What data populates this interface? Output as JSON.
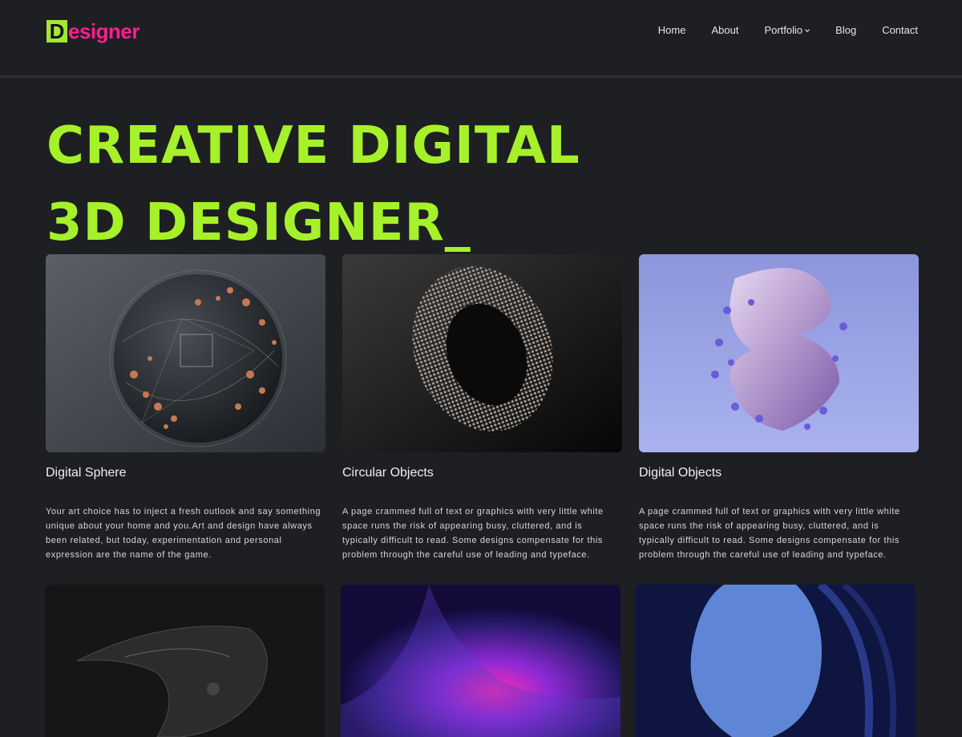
{
  "logo": {
    "initial": "D",
    "rest": "esigner"
  },
  "nav": {
    "items": [
      {
        "label": "Home"
      },
      {
        "label": "About"
      },
      {
        "label": "Portfolio"
      },
      {
        "label": "Blog"
      },
      {
        "label": "Contact"
      }
    ]
  },
  "hero": {
    "line1": "CREATIVE DIGITAL",
    "line2": "3D DESIGNER_"
  },
  "cards": [
    {
      "title": "Digital Sphere",
      "desc": "Your art choice has to inject a fresh outlook and say something unique about your home and you.Art and design have always been related, but today, experimentation and personal expression are the name of the game."
    },
    {
      "title": "Circular Objects",
      "desc": "A page crammed full of text or graphics with very little white space runs the risk of appearing busy, cluttered, and is typically difficult to read. Some designs compensate for this problem through the careful use of leading and typeface."
    },
    {
      "title": "Digital Objects",
      "desc": "A page crammed full of text or graphics with very little white space runs the risk of appearing busy, cluttered, and is typically difficult to read. Some designs compensate for this problem through the careful use of leading and typeface."
    }
  ],
  "colors": {
    "background": "#1e1f22",
    "accent_green": "#a6f12a",
    "logo_pink": "#ff1f8e"
  }
}
